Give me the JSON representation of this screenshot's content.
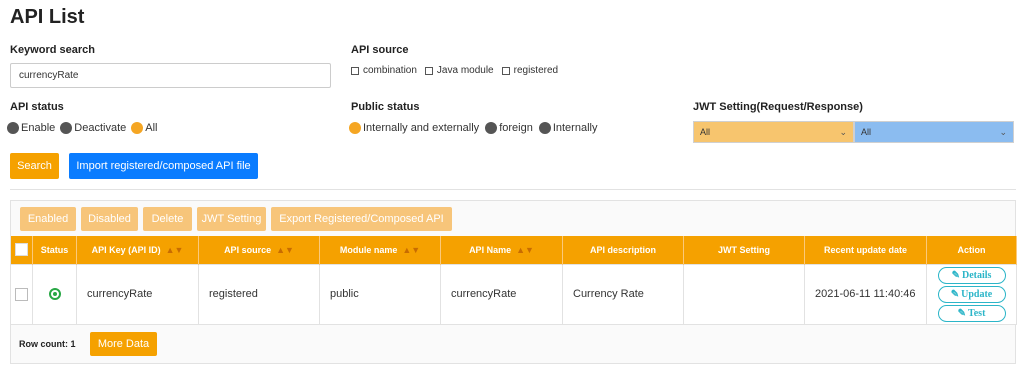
{
  "page": {
    "title": "API List"
  },
  "filters": {
    "keyword_label": "Keyword search",
    "keyword_value": "currencyRate",
    "source_label": "API source",
    "source_options": [
      "combination",
      "Java module",
      "registered"
    ],
    "status_label": "API status",
    "status_options": [
      {
        "label": "Enable",
        "selected": false
      },
      {
        "label": "Deactivate",
        "selected": false
      },
      {
        "label": "All",
        "selected": true
      }
    ],
    "public_label": "Public status",
    "public_options": [
      {
        "label": "Internally and externally",
        "selected": true
      },
      {
        "label": "foreign",
        "selected": false
      },
      {
        "label": "Internally",
        "selected": false
      }
    ],
    "jwt_label": "JWT Setting(Request/Response)",
    "jwt_request_value": "All",
    "jwt_response_value": "All"
  },
  "actions": {
    "search": "Search",
    "import": "Import registered/composed API file"
  },
  "toolbar": {
    "enabled": "Enabled",
    "disabled": "Disabled",
    "delete": "Delete",
    "jwt_setting": "JWT Setting",
    "export": "Export Registered/Composed API"
  },
  "table": {
    "headers": [
      "Status",
      "API Key (API ID)",
      "API source",
      "Module name",
      "API Name",
      "API description",
      "JWT Setting",
      "Recent update date",
      "Action"
    ],
    "rows": [
      {
        "api_key": "currencyRate",
        "api_source": "registered",
        "module_name": "public",
        "api_name": "currencyRate",
        "api_description": "Currency Rate",
        "jwt_setting": "",
        "updated": "2021-06-11 11:40:46",
        "actions": [
          "Details",
          "Update",
          "Test"
        ]
      }
    ]
  },
  "footer": {
    "row_count": "Row count: 1",
    "more_data": "More Data"
  },
  "colors": {
    "accent_orange": "#f5a100",
    "accent_blue": "#0a7cff",
    "action_teal": "#2bb5c8",
    "status_green": "#28a745"
  }
}
